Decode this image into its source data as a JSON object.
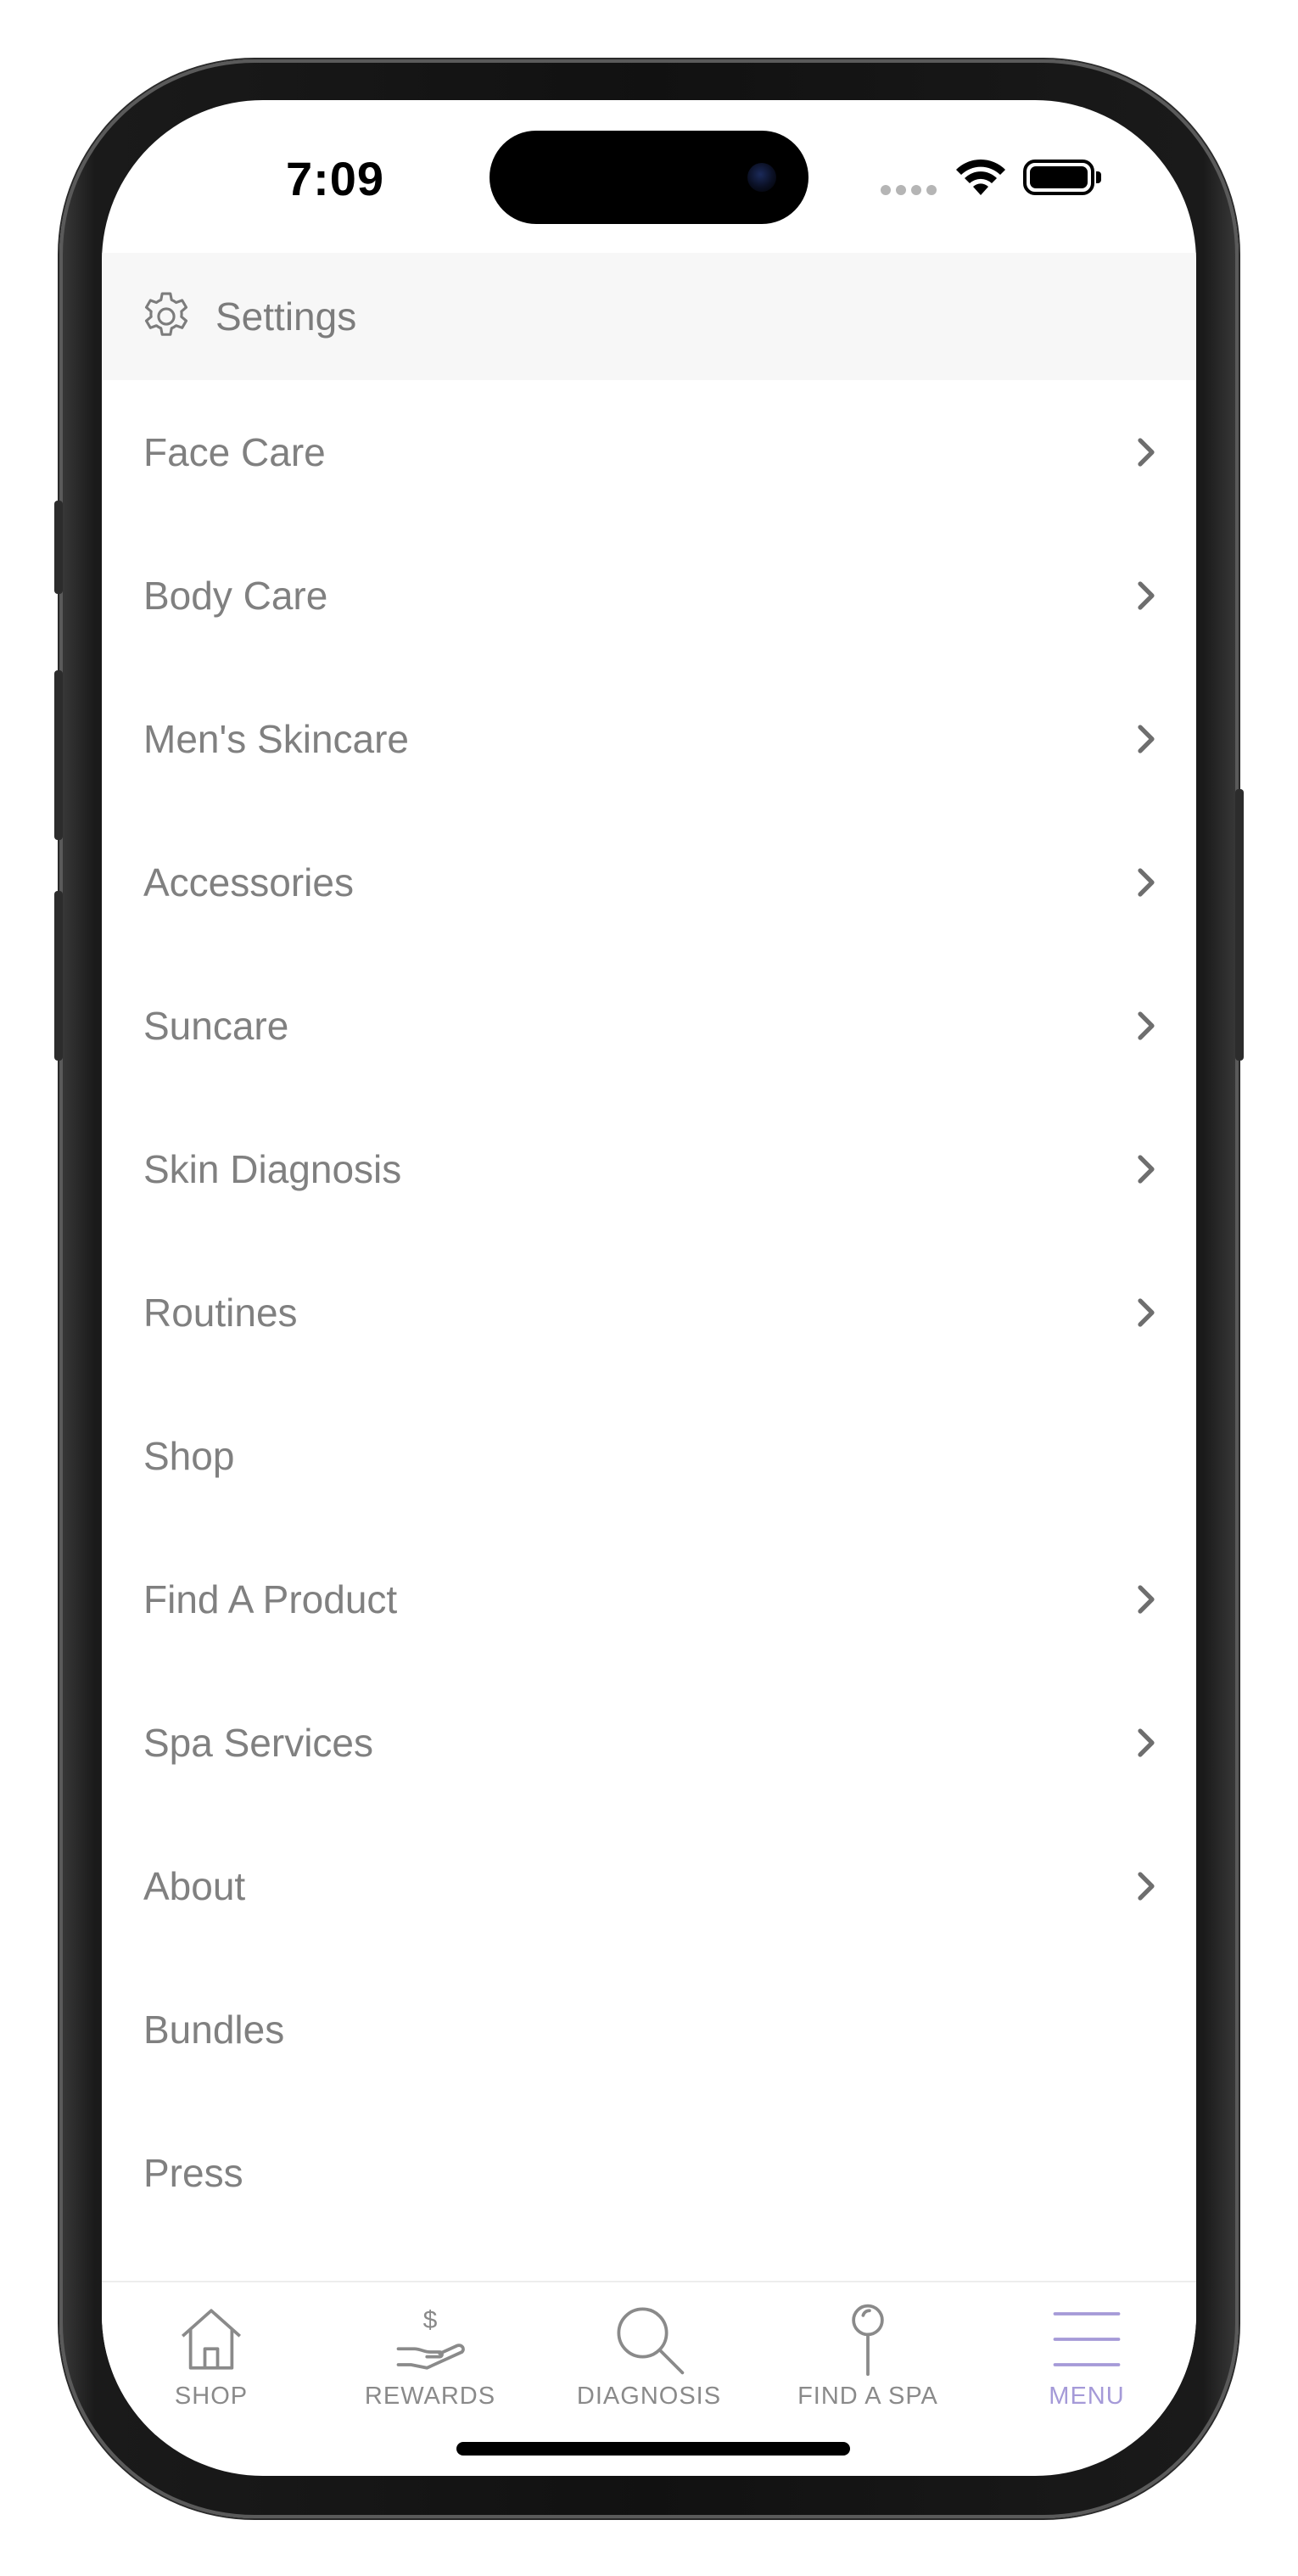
{
  "status_bar": {
    "time": "7:09"
  },
  "settings": {
    "label": "Settings",
    "icon": "gear-icon"
  },
  "menu": {
    "items": [
      {
        "label": "Face Care",
        "has_chevron": true
      },
      {
        "label": "Body Care",
        "has_chevron": true
      },
      {
        "label": "Men's Skincare",
        "has_chevron": true
      },
      {
        "label": "Accessories",
        "has_chevron": true
      },
      {
        "label": "Suncare",
        "has_chevron": true
      },
      {
        "label": "Skin Diagnosis",
        "has_chevron": true
      },
      {
        "label": "Routines",
        "has_chevron": true
      },
      {
        "label": "Shop",
        "has_chevron": false
      },
      {
        "label": "Find A Product",
        "has_chevron": true
      },
      {
        "label": "Spa Services",
        "has_chevron": true
      },
      {
        "label": "About",
        "has_chevron": true
      },
      {
        "label": "Bundles",
        "has_chevron": false
      },
      {
        "label": "Press",
        "has_chevron": false
      }
    ]
  },
  "tab_bar": {
    "tabs": [
      {
        "label": "SHOP",
        "icon": "home-icon",
        "active": false
      },
      {
        "label": "REWARDS",
        "icon": "hand-dollar-icon",
        "active": false
      },
      {
        "label": "DIAGNOSIS",
        "icon": "magnifier-icon",
        "active": false
      },
      {
        "label": "FIND A SPA",
        "icon": "map-pin-icon",
        "active": false
      },
      {
        "label": "MENU",
        "icon": "hamburger-menu-icon",
        "active": true
      }
    ]
  },
  "colors": {
    "text_gray": "#808080",
    "header_bg": "#f7f7f7",
    "active_tab": "#a59ad8",
    "inactive_tab": "#8a8a8a"
  }
}
